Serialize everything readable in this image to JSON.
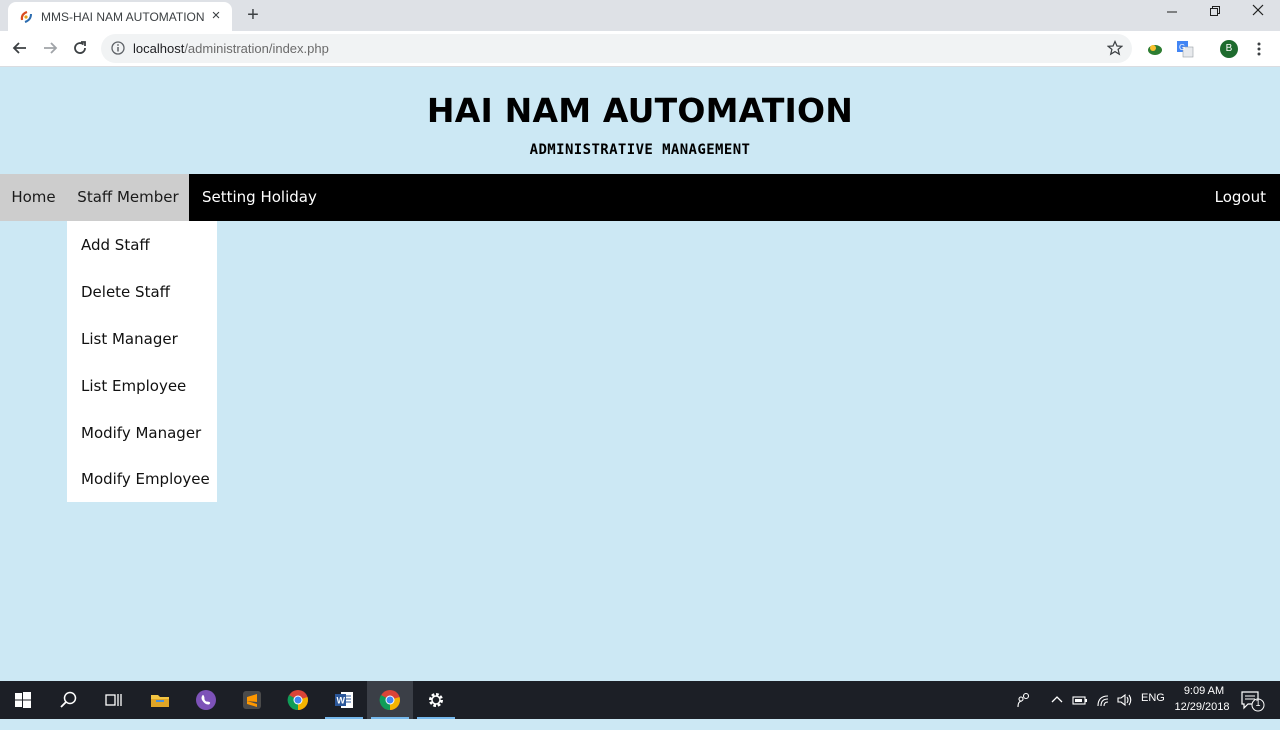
{
  "browser": {
    "tab_title": "MMS-HAI NAM AUTOMATION",
    "tab_close": "×",
    "new_tab": "+",
    "url_host": "localhost",
    "url_path": "/administration/index.php",
    "profile_initial": "B"
  },
  "header": {
    "title": "HAI NAM AUTOMATION",
    "subtitle": "ADMINISTRATIVE MANAGEMENT"
  },
  "nav": {
    "home": "Home",
    "staff_member": "Staff Member",
    "setting_holiday": "Setting Holiday",
    "logout": "Logout"
  },
  "dropdown": {
    "items": [
      "Add Staff",
      "Delete Staff",
      "List Manager",
      "List Employee",
      "Modify Manager",
      "Modify Employee"
    ]
  },
  "taskbar": {
    "language": "ENG",
    "time": "9:09 AM",
    "date": "12/29/2018",
    "notification_count": "1"
  },
  "colors": {
    "page_background": "#cce8f4",
    "navbar_background": "#000000",
    "nav_active_background": "#cdcdcd",
    "dropdown_background": "#ffffff"
  }
}
